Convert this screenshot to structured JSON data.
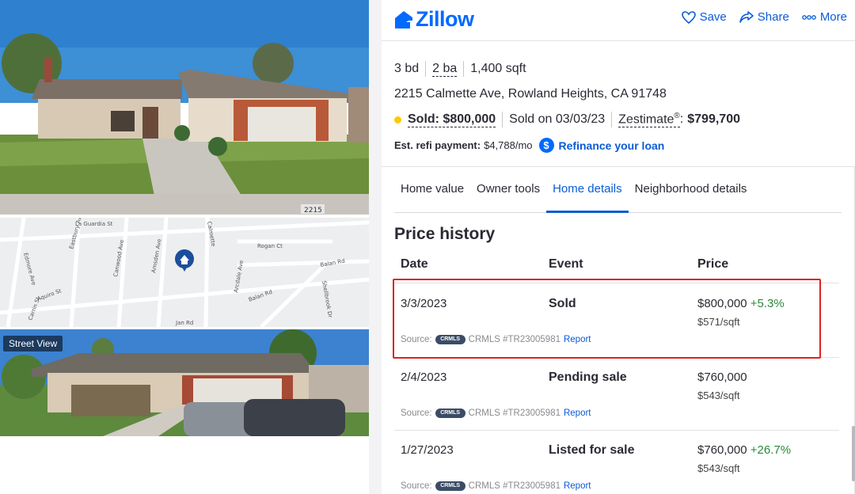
{
  "media": {
    "street_view_label": "Street View",
    "house_number": "2215"
  },
  "map": {
    "streets": [
      "La Guardia St",
      "Edmore Ave",
      "Eastbury Ave",
      "Canwood Ave",
      "Amsden Ave",
      "Calmette",
      "Rogan Ct",
      "Balan Rd",
      "Balan Rd",
      "Arcdale Ave",
      "Shellbrook Dr",
      "Aquiro St",
      "Carrin St",
      "Jan Rd"
    ]
  },
  "header": {
    "logo_text": "Zillow",
    "save_label": "Save",
    "share_label": "Share",
    "more_label": "More"
  },
  "summary": {
    "beds": "3 bd",
    "baths": "2 ba",
    "sqft": "1,400 sqft",
    "address": "2215 Calmette Ave, Rowland Heights, CA 91748",
    "sold_label": "Sold: $800,000",
    "sold_on": "Sold on 03/03/23",
    "zestimate_label": "Zestimate",
    "zestimate_mark": "®",
    "zestimate_colon": ":",
    "zestimate_value": "$799,700",
    "refi_label": "Est. refi payment:",
    "refi_value": "$4,788/mo",
    "refi_link": "Refinance your loan",
    "status_color": "#ffc800"
  },
  "tabs": [
    {
      "label": "Home value",
      "active": false
    },
    {
      "label": "Owner tools",
      "active": false
    },
    {
      "label": "Home details",
      "active": true
    },
    {
      "label": "Neighborhood details",
      "active": false
    }
  ],
  "price_history": {
    "title": "Price history",
    "columns": {
      "date": "Date",
      "event": "Event",
      "price": "Price"
    },
    "source_prefix": "Source:",
    "source_badge": "CRMLS",
    "report_label": "Report",
    "rows": [
      {
        "date": "3/3/2023",
        "event": "Sold",
        "price": "$800,000",
        "change": "+5.3%",
        "per_sqft": "$571/sqft",
        "source": "CRMLS #TR23005981"
      },
      {
        "date": "2/4/2023",
        "event": "Pending sale",
        "price": "$760,000",
        "change": "",
        "per_sqft": "$543/sqft",
        "source": "CRMLS #TR23005981"
      },
      {
        "date": "1/27/2023",
        "event": "Listed for sale",
        "price": "$760,000",
        "change": "+26.7%",
        "per_sqft": "$543/sqft",
        "source": "CRMLS #TR23005981"
      }
    ]
  },
  "colors": {
    "accent": "#006aff",
    "link": "#0a5bd6",
    "positive": "#2a8a3a",
    "highlight": "#e02020"
  }
}
